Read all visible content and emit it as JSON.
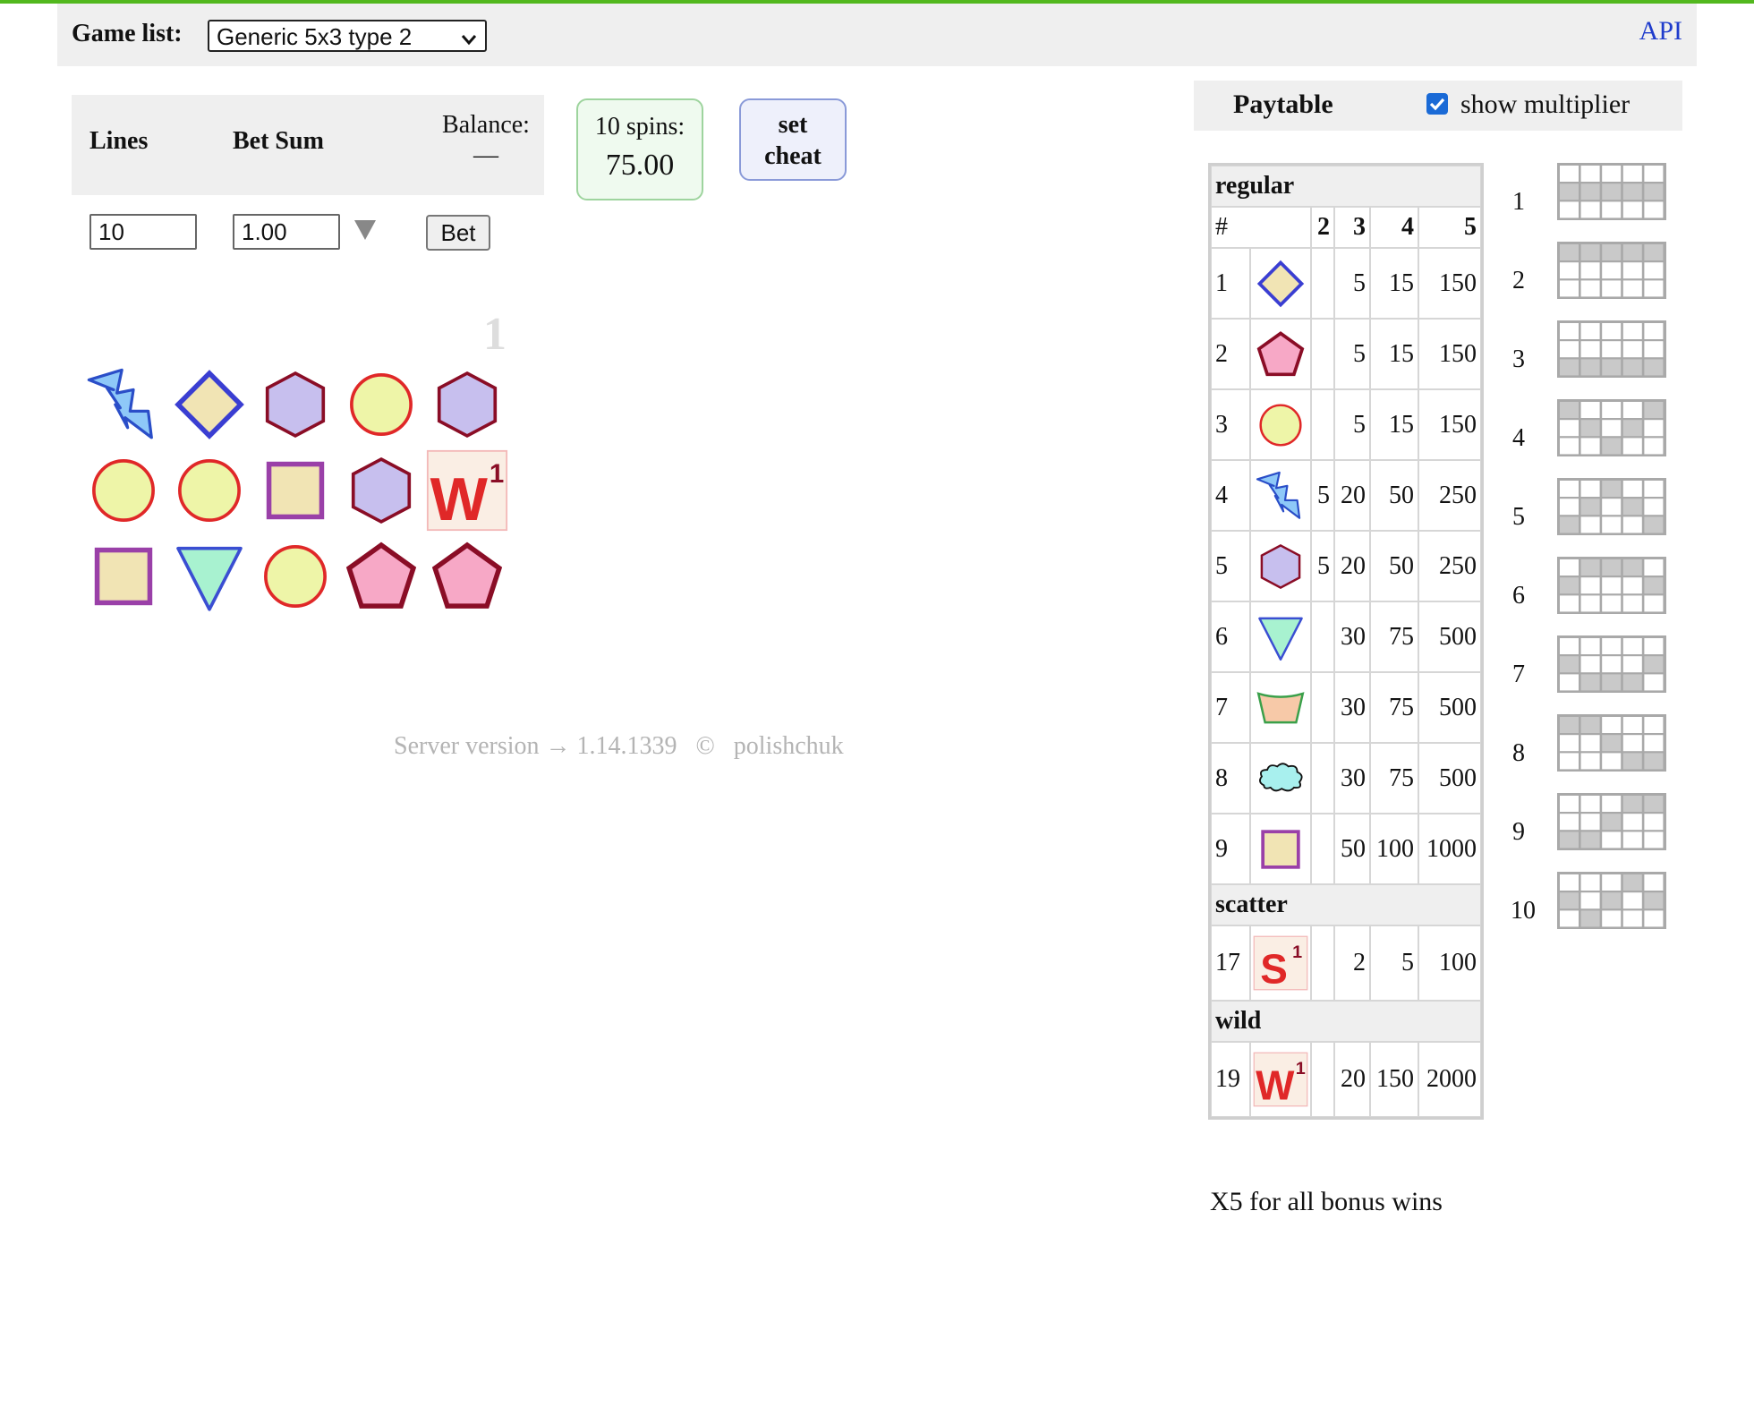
{
  "header": {
    "game_list_label": "Game list:",
    "game_selected": "Generic 5x3 type 2",
    "api_link": "API"
  },
  "controls": {
    "lines_label": "Lines",
    "bet_sum_label": "Bet Sum",
    "balance_label": "Balance:",
    "balance_value": "—",
    "lines_value": "10",
    "bet_sum_value": "1.00",
    "bet_button": "Bet",
    "spins_label": "10 spins:",
    "spins_value": "75.00",
    "cheat_line1": "set",
    "cheat_line2": "cheat"
  },
  "reels": {
    "line_number": "1",
    "grid": [
      [
        "lightning",
        "diamond",
        "hexagon",
        "circle",
        "hexagon"
      ],
      [
        "circle",
        "circle",
        "square",
        "hexagon",
        "wild"
      ],
      [
        "square",
        "triangle",
        "circle",
        "pentagon",
        "pentagon"
      ]
    ]
  },
  "footer": {
    "server_text": "Server version → 1.14.1339   ©   polishchuk"
  },
  "paytable": {
    "title": "Paytable",
    "show_multiplier_label": "show multiplier",
    "show_multiplier_checked": true,
    "header": [
      "#",
      "2",
      "3",
      "4",
      "5"
    ],
    "sections": [
      {
        "name": "regular",
        "rows": [
          {
            "id": "1",
            "symbol": "diamond",
            "pays": [
              "",
              "5",
              "15",
              "150"
            ]
          },
          {
            "id": "2",
            "symbol": "pentagon",
            "pays": [
              "",
              "5",
              "15",
              "150"
            ]
          },
          {
            "id": "3",
            "symbol": "circle",
            "pays": [
              "",
              "5",
              "15",
              "150"
            ]
          },
          {
            "id": "4",
            "symbol": "lightning",
            "pays": [
              "5",
              "20",
              "50",
              "250"
            ]
          },
          {
            "id": "5",
            "symbol": "hexagon",
            "pays": [
              "5",
              "20",
              "50",
              "250"
            ]
          },
          {
            "id": "6",
            "symbol": "triangle",
            "pays": [
              "",
              "30",
              "75",
              "500"
            ]
          },
          {
            "id": "7",
            "symbol": "trapezoid",
            "pays": [
              "",
              "30",
              "75",
              "500"
            ]
          },
          {
            "id": "8",
            "symbol": "cloud",
            "pays": [
              "",
              "30",
              "75",
              "500"
            ]
          },
          {
            "id": "9",
            "symbol": "square",
            "pays": [
              "",
              "50",
              "100",
              "1000"
            ]
          }
        ]
      },
      {
        "name": "scatter",
        "rows": [
          {
            "id": "17",
            "symbol": "scatter",
            "pays": [
              "",
              "2",
              "5",
              "100"
            ]
          }
        ]
      },
      {
        "name": "wild",
        "rows": [
          {
            "id": "19",
            "symbol": "wild",
            "pays": [
              "",
              "20",
              "150",
              "2000"
            ]
          }
        ]
      }
    ],
    "bonus_note": "Χ5 for all bonus wins"
  },
  "lines": [
    {
      "n": "1",
      "pattern": [
        1,
        1,
        1,
        1,
        1
      ]
    },
    {
      "n": "2",
      "pattern": [
        0,
        0,
        0,
        0,
        0
      ]
    },
    {
      "n": "3",
      "pattern": [
        2,
        2,
        2,
        2,
        2
      ]
    },
    {
      "n": "4",
      "pattern": [
        0,
        1,
        2,
        1,
        0
      ]
    },
    {
      "n": "5",
      "pattern": [
        2,
        1,
        0,
        1,
        2
      ]
    },
    {
      "n": "6",
      "pattern": [
        1,
        0,
        0,
        0,
        1
      ]
    },
    {
      "n": "7",
      "pattern": [
        1,
        2,
        2,
        2,
        1
      ]
    },
    {
      "n": "8",
      "pattern": [
        0,
        0,
        1,
        2,
        2
      ]
    },
    {
      "n": "9",
      "pattern": [
        2,
        2,
        1,
        0,
        0
      ]
    },
    {
      "n": "10",
      "pattern": [
        1,
        2,
        1,
        0,
        1
      ]
    }
  ],
  "colors": {
    "accent_green": "#52b81e",
    "link_blue": "#1f3ccc",
    "panel_gray": "#efefef"
  }
}
